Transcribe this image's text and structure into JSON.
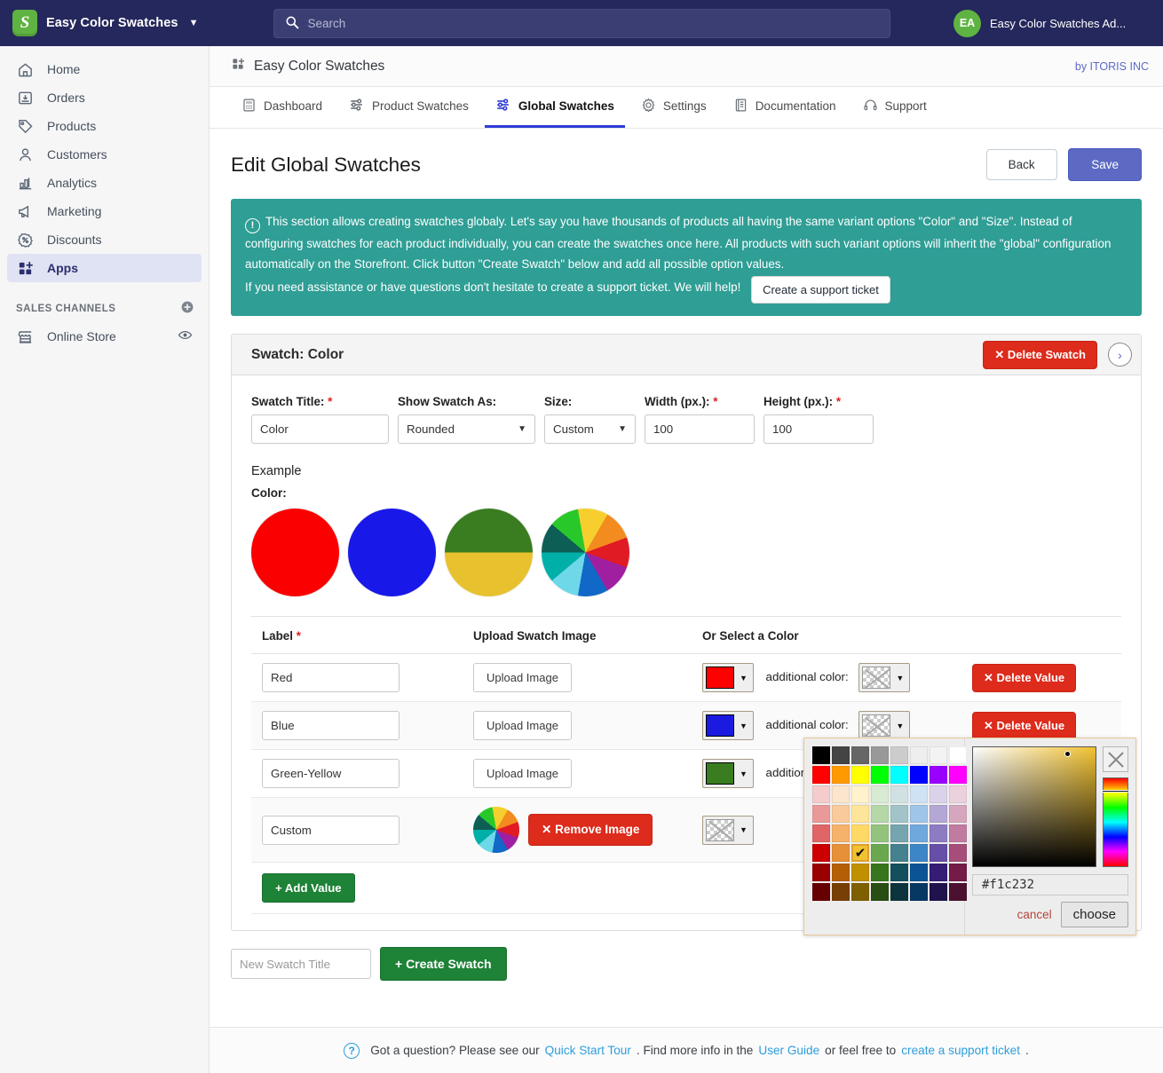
{
  "topbar": {
    "store_name": "Easy Color Swatches",
    "search_placeholder": "Search",
    "user_initials": "EA",
    "user_name": "Easy Color Swatches Ad..."
  },
  "sidebar": {
    "items": [
      {
        "label": "Home",
        "icon": "home-icon",
        "active": false
      },
      {
        "label": "Orders",
        "icon": "orders-icon",
        "active": false
      },
      {
        "label": "Products",
        "icon": "products-tag-icon",
        "active": false
      },
      {
        "label": "Customers",
        "icon": "customers-icon",
        "active": false
      },
      {
        "label": "Analytics",
        "icon": "analytics-bars-icon",
        "active": false
      },
      {
        "label": "Marketing",
        "icon": "marketing-megaphone-icon",
        "active": false
      },
      {
        "label": "Discounts",
        "icon": "discounts-percent-icon",
        "active": false
      },
      {
        "label": "Apps",
        "icon": "apps-grid-plus-icon",
        "active": true
      }
    ],
    "channels_heading": "SALES CHANNELS",
    "channels": [
      {
        "label": "Online Store",
        "icon": "store-icon"
      }
    ]
  },
  "app_header": {
    "title": "Easy Color Swatches",
    "vendor": "by ITORIS INC"
  },
  "tabs": [
    {
      "label": "Dashboard",
      "icon": "dashboard-icon",
      "active": false
    },
    {
      "label": "Product Swatches",
      "icon": "sliders-icon",
      "active": false
    },
    {
      "label": "Global Swatches",
      "icon": "sliders-icon",
      "active": true
    },
    {
      "label": "Settings",
      "icon": "gear-icon",
      "active": false
    },
    {
      "label": "Documentation",
      "icon": "document-icon",
      "active": false
    },
    {
      "label": "Support",
      "icon": "headset-icon",
      "active": false
    }
  ],
  "page": {
    "title": "Edit Global Swatches",
    "back_label": "Back",
    "save_label": "Save"
  },
  "banner": {
    "line1": "This section allows creating swatches globaly. Let's say you have thousands of products all having the same variant options \"Color\" and \"Size\". Instead of configuring swatches for each product individually, you can create the swatches once here. All products with such variant options will inherit the \"global\" configuration automatically on the Storefront. Click button \"Create Swatch\" below and add all possible option values.",
    "line2": "If you need assistance or have questions don't hesitate to create a support ticket. We will help!",
    "button_label": "Create a support ticket",
    "bg_color": "#2f9e95"
  },
  "swatch_panel": {
    "title": "Swatch: Color",
    "delete_label": "Delete Swatch",
    "next_arrow": "›",
    "fields": {
      "swatch_title_label": "Swatch Title:",
      "swatch_title_value": "Color",
      "show_as_label": "Show Swatch As:",
      "show_as_value": "Rounded",
      "size_label": "Size:",
      "size_value": "Custom",
      "width_label": "Width (px.):",
      "width_value": "100",
      "height_label": "Height (px.):",
      "height_value": "100"
    },
    "example_label": "Example",
    "example_color_label": "Color:",
    "example_circles": [
      {
        "name": "red-circle",
        "type": "solid",
        "colors": [
          "#fa0000"
        ]
      },
      {
        "name": "blue-circle",
        "type": "solid",
        "colors": [
          "#1818e8"
        ]
      },
      {
        "name": "green-yellow-circle",
        "type": "half",
        "colors": [
          "#3a7d20",
          "#e8c12f"
        ]
      },
      {
        "name": "multicolor-pie-circle",
        "type": "pie",
        "colors": [
          "#f6cf2e",
          "#f28c1e",
          "#e01b24",
          "#a01fa0",
          "#1168c6",
          "#6ed8e8",
          "#00b0a8",
          "#0d5f55",
          "#29c82a"
        ]
      }
    ],
    "table": {
      "headers": [
        "Label",
        "Upload Swatch Image",
        "Or Select a Color",
        ""
      ],
      "upload_label": "Upload Image",
      "remove_image_label": "Remove Image",
      "additional_color_label": "additional color:",
      "delete_value_label": "Delete Value",
      "rows": [
        {
          "label": "Red",
          "has_image": false,
          "color": "#ff0000",
          "additional_color": null
        },
        {
          "label": "Blue",
          "has_image": false,
          "color": "#1a1ae0",
          "additional_color": null
        },
        {
          "label": "Green-Yellow",
          "has_image": false,
          "color": "#3a7d20",
          "additional_color": "#f1c232"
        },
        {
          "label": "Custom",
          "has_image": true,
          "color": null,
          "additional_color": null
        }
      ]
    },
    "add_value_label": "+ Add Value"
  },
  "create_swatch": {
    "placeholder": "New Swatch Title",
    "button_label": "+ Create Swatch"
  },
  "color_picker": {
    "hex_value": "#f1c232",
    "cancel_label": "cancel",
    "choose_label": "choose",
    "close_icon": "close-x-icon",
    "selected_swatch_index": 42,
    "palette": [
      "#000000",
      "#444444",
      "#666666",
      "#999999",
      "#cccccc",
      "#eeeeee",
      "#f3f3f3",
      "#ffffff",
      "#ff0000",
      "#ff9900",
      "#ffff00",
      "#00ff00",
      "#00ffff",
      "#0000ff",
      "#9900ff",
      "#ff00ff",
      "#f4cccc",
      "#fce5cd",
      "#fff2cc",
      "#d9ead3",
      "#d0e0e3",
      "#cfe2f3",
      "#d9d2e9",
      "#ead1dc",
      "#ea9999",
      "#f9cb9c",
      "#ffe599",
      "#b6d7a8",
      "#a2c4c9",
      "#9fc5e8",
      "#b4a7d6",
      "#d5a6bd",
      "#e06666",
      "#f6b26b",
      "#ffd966",
      "#93c47d",
      "#76a5af",
      "#6fa8dc",
      "#8e7cc3",
      "#c27ba0",
      "#cc0000",
      "#e69138",
      "#f1c232",
      "#6aa84f",
      "#45818e",
      "#3d85c6",
      "#674ea7",
      "#a64d79",
      "#990000",
      "#b45f06",
      "#bf9000",
      "#38761d",
      "#134f5c",
      "#0b5394",
      "#351c75",
      "#741b47",
      "#660000",
      "#783f04",
      "#7f6000",
      "#274e13",
      "#0c343d",
      "#073763",
      "#20124d",
      "#4c1130"
    ]
  },
  "footer": {
    "prefix": "Got a question? Please see our ",
    "link1": "Quick Start Tour",
    "mid1": ". Find more info in the ",
    "link2": "User Guide",
    "mid2": " or feel free to ",
    "link3": "create a support ticket",
    "suffix": "."
  }
}
